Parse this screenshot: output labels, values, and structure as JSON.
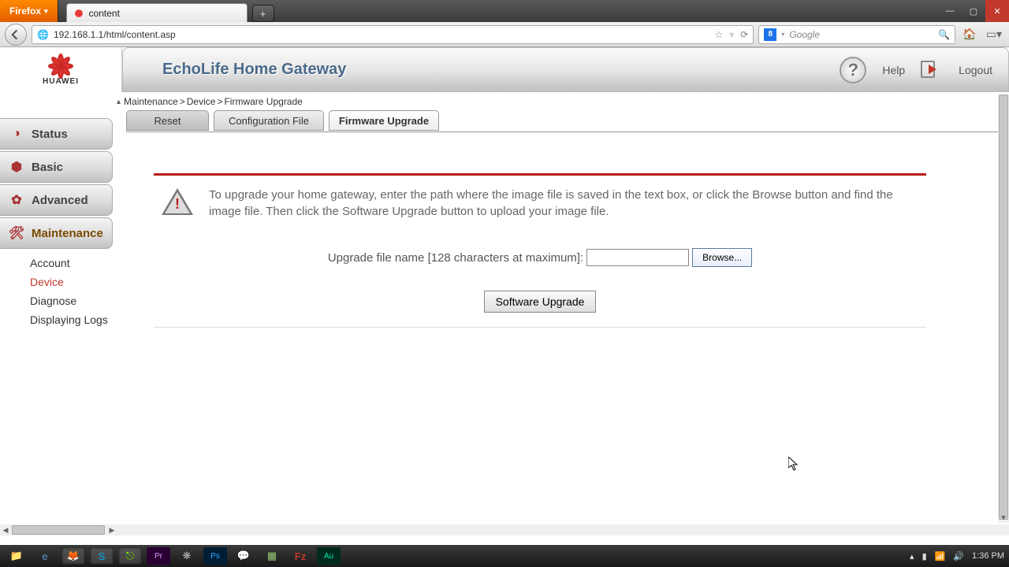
{
  "browser": {
    "menu_label": "Firefox",
    "tab_title": "content",
    "url": "192.168.1.1/html/content.asp",
    "search_placeholder": "Google",
    "search_provider_initial": "8"
  },
  "header": {
    "title": "EchoLife Home Gateway",
    "help_label": "Help",
    "logout_label": "Logout",
    "brand": "HUAWEI"
  },
  "breadcrumb": {
    "a": "Maintenance",
    "b": "Device",
    "c": "Firmware Upgrade",
    "sep": ">"
  },
  "sidebar": {
    "items": [
      {
        "label": "Status"
      },
      {
        "label": "Basic"
      },
      {
        "label": "Advanced"
      },
      {
        "label": "Maintenance"
      }
    ],
    "sub": [
      {
        "label": "Account"
      },
      {
        "label": "Device"
      },
      {
        "label": "Diagnose"
      },
      {
        "label": "Displaying Logs"
      }
    ]
  },
  "tabs": [
    {
      "label": "Reset"
    },
    {
      "label": "Configuration File"
    },
    {
      "label": "Firmware Upgrade"
    }
  ],
  "panel": {
    "warning": "To upgrade your home gateway, enter the path where the image file is saved in the text box, or click the Browse button and find the image file. Then click the Software Upgrade button to upload your image file.",
    "file_label": "Upgrade file name [128 characters at maximum]:",
    "browse_label": "Browse...",
    "upgrade_label": "Software Upgrade"
  },
  "taskbar": {
    "clock": "1:36 PM"
  }
}
